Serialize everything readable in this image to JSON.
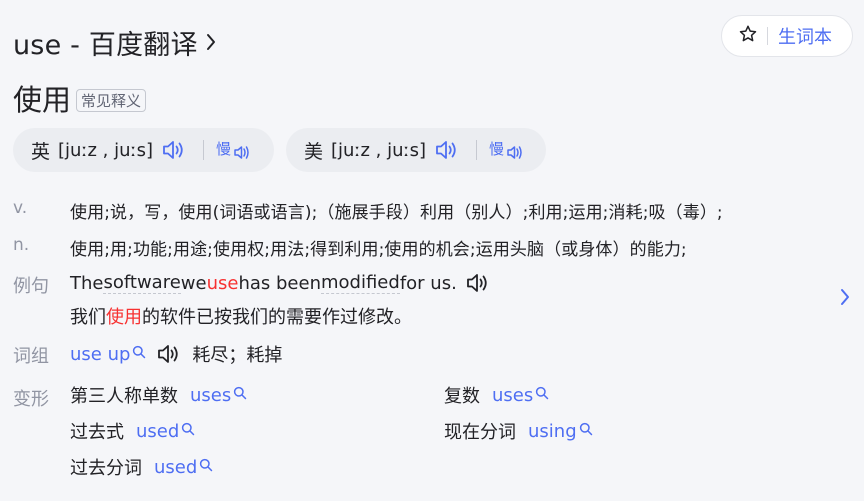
{
  "header": {
    "title": "use - 百度翻译",
    "vocab_label": "生词本"
  },
  "entry": {
    "headword": "使用",
    "badge": "常见释义"
  },
  "pronunciations": [
    {
      "lang": "英",
      "ipa": "[juːz , juːs]"
    },
    {
      "lang": "美",
      "ipa": "[juːz , juːs]"
    }
  ],
  "definitions": [
    {
      "pos": "v.",
      "text": "使用;说，写，使用(词语或语言);（施展手段）利用（别人）;利用;运用;消耗;吸（毒）;"
    },
    {
      "pos": "n.",
      "text": "使用;用;功能;用途;使用权;用法;得到利用;使用的机会;运用头脑（或身体）的能力;"
    }
  ],
  "example": {
    "label": "例句",
    "en_before": "The ",
    "en_w1": "software",
    "en_mid1": " we ",
    "en_highlight": "use",
    "en_mid2": " has been ",
    "en_w2": "modified",
    "en_after": " for us.",
    "zh_before": "我们",
    "zh_highlight": "使用",
    "zh_after": "的软件已按我们的需要作过修改。"
  },
  "phrases": {
    "label": "词组",
    "items": [
      {
        "phrase": "use up",
        "meaning": "耗尽；耗掉"
      }
    ]
  },
  "forms": {
    "label": "变形",
    "items": [
      {
        "label": "第三人称单数",
        "value": "uses"
      },
      {
        "label": "复数",
        "value": "uses"
      },
      {
        "label": "过去式",
        "value": "used"
      },
      {
        "label": "现在分词",
        "value": "using"
      },
      {
        "label": "过去分词",
        "value": "used"
      }
    ]
  },
  "colors": {
    "accent": "#4e6ef2",
    "highlight": "#f73131",
    "muted": "#9195a3",
    "background": "#f5f6f9"
  },
  "icons": {
    "title_chevron": "chevron-right-icon",
    "vocab": "star-icon",
    "speaker": "speaker-icon",
    "slow_speaker": "slow-speaker-icon",
    "search": "search-icon",
    "example_next": "chevron-right-icon"
  }
}
